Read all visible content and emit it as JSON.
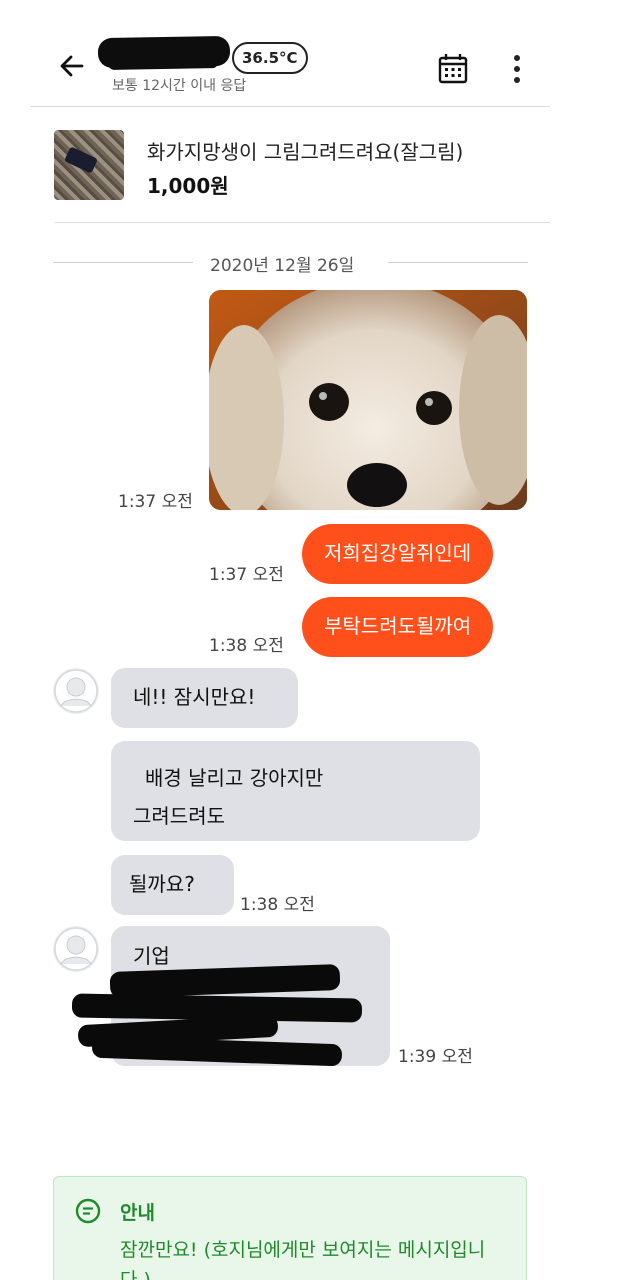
{
  "header": {
    "temperature": "36.5°C",
    "response_time": "보통 12시간 이내 응답",
    "icons": [
      "back-arrow-icon",
      "calendar-icon",
      "more-vertical-icon"
    ]
  },
  "product": {
    "title": "화가지망생이 그림그려드려요(잘그림)",
    "price": "1,000원"
  },
  "chat": {
    "date": "2020년 12월 26일",
    "messages": [
      {
        "from": "me",
        "type": "image",
        "description_icon": "dog-photo",
        "time": "1:37 오전"
      },
      {
        "from": "me",
        "text": "저희집강알쥐인데",
        "time": "1:37 오전"
      },
      {
        "from": "me",
        "text": "부탁드려도될까여",
        "time": "1:38 오전"
      },
      {
        "from": "other",
        "text": "네!! 잠시만요!"
      },
      {
        "from": "other",
        "line1": "배경 날리고 강아지만",
        "line2": "그려드려도"
      },
      {
        "from": "other",
        "text": "될까요?",
        "time": "1:38 오전"
      },
      {
        "from": "other",
        "text": "기업",
        "time": "1:39 오전"
      }
    ]
  },
  "notice": {
    "title": "안내",
    "body": "잠깐만요! (호지님에게만 보여지는 메시지입니다.)"
  },
  "colors": {
    "my_bubble": "#ff4f1a",
    "other_bubble": "#dfe0e5",
    "notice_text": "#1f8a2a",
    "notice_bg": "#e9f7ea"
  }
}
